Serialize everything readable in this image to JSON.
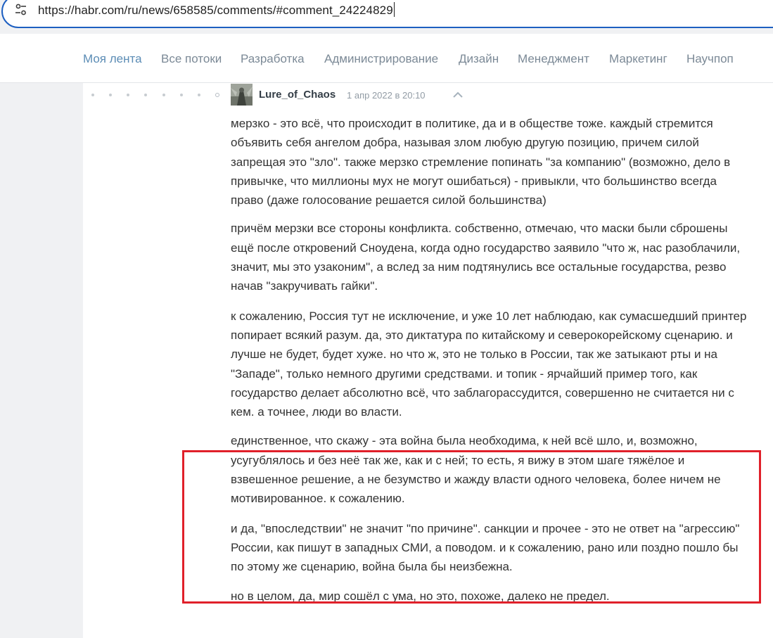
{
  "browser": {
    "url": "https://habr.com/ru/news/658585/comments/#comment_24224829",
    "site_settings_icon": "tune-icon"
  },
  "nav": {
    "items": [
      {
        "label": "Моя лента",
        "active": true
      },
      {
        "label": "Все потоки",
        "active": false
      },
      {
        "label": "Разработка",
        "active": false
      },
      {
        "label": "Администрирование",
        "active": false
      },
      {
        "label": "Дизайн",
        "active": false
      },
      {
        "label": "Менеджмент",
        "active": false
      },
      {
        "label": "Маркетинг",
        "active": false
      },
      {
        "label": "Научпоп",
        "active": false
      }
    ]
  },
  "comment": {
    "author": "Lure_of_Chaos",
    "time": "1 апр 2022 в 20:10",
    "parent_icon": "chevron-up-icon",
    "paragraphs": [
      "мерзко - это всё, что происходит в политике, да и в обществе тоже. каждый стремится объявить себя ангелом добра, называя злом любую другую позицию, причем силой запрещая это \"зло\". также мерзко стремление попинать \"за компанию\" (возможно, дело в привычке, что миллионы мух не могут ошибаться) - привыкли, что большинство всегда право (даже голосование решается силой большинства)",
      "причём мерзки все стороны конфликта. собственно, отмечаю, что маски были сброшены ещё после откровений Сноудена, когда одно государство заявило \"что ж, нас разоблачили, значит, мы это узаконим\", а вслед за ним подтянулись все остальные государства, резво начав \"закручивать гайки\".",
      "к сожалению, Россия тут не исключение, и уже 10 лет наблюдаю, как сумасшедший принтер попирает всякий разум. да, это диктатура по китайскому и северокорейскому сценарию. и лучше не будет, будет хуже. но что ж, это не только в России, так же затыкают рты и на \"Западе\", только немного другими средствами. и топик - ярчайший пример того, как государство делает абсолютно всё, что заблагорассудится, совершенно не считается ни с кем. а точнее, люди во власти.",
      "единственное, что скажу - эта война была необходима, к ней всё шло, и, возможно, усугублялось и без неё так же, как и с ней; то есть, я вижу в этом шаге тяжёлое и взвешенное решение, а не безумство и жажду власти одного человека, более ничем не мотивированное. к сожалению.",
      "и да, \"впоследствии\" не значит \"по причине\". санкции и прочее - это не ответ на \"агрессию\" России, как пишут в западных СМИ, а поводом. и к сожалению, рано или поздно пошло бы по этому же сценарию, война была бы неизбежна.",
      "но в целом, да, мир сошёл с ума, но это, похоже, далеко не предел."
    ]
  },
  "colors": {
    "highlight": "#e0202a",
    "nav_active": "#5b8cb5",
    "nav_text": "#7b8996",
    "focus_ring": "#1d5fc1"
  }
}
